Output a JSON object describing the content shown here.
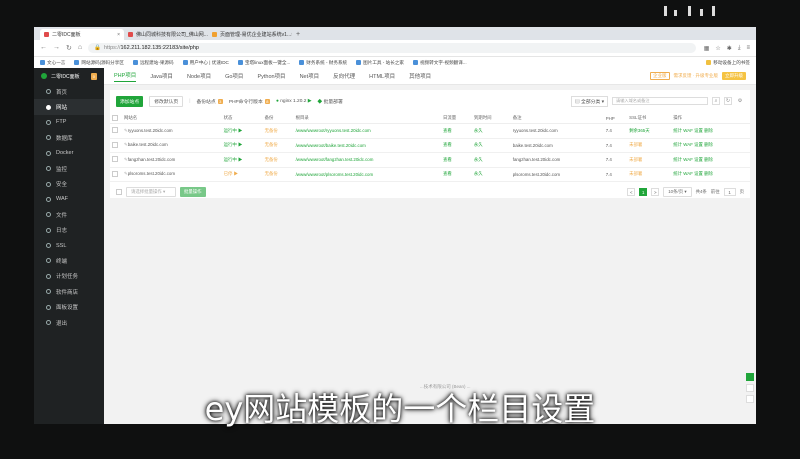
{
  "browser": {
    "tabs": [
      {
        "label": "二零IDC面板"
      },
      {
        "label": "佛山同城科技有限公司_佛山网..."
      },
      {
        "label": "页面管理-易优企业建站系统v1..."
      }
    ],
    "new_tab": "+",
    "url_prefix": "https://",
    "url": "162.211.182.135:22183/site/php",
    "bookmarks": [
      "文心一言",
      "网站源码|源码分享区",
      "远程建站-果源码",
      "用户中心 | 优速IDC",
      "宝塔linux面板一键全...",
      "财务系统 - 财务系统",
      "图片工具 - 站长之家",
      "视频转文字-视频翻译..."
    ],
    "bookmarks_right": "移动设备上的书签"
  },
  "sidebar": {
    "title": "二零IDC面板",
    "badge": "0",
    "items": [
      {
        "label": "首页"
      },
      {
        "label": "网站"
      },
      {
        "label": "FTP"
      },
      {
        "label": "数据库"
      },
      {
        "label": "Docker"
      },
      {
        "label": "监控"
      },
      {
        "label": "安全"
      },
      {
        "label": "WAF"
      },
      {
        "label": "文件"
      },
      {
        "label": "日志"
      },
      {
        "label": "SSL"
      },
      {
        "label": "终端"
      },
      {
        "label": "计划任务"
      },
      {
        "label": "软件商店"
      },
      {
        "label": "面板设置"
      },
      {
        "label": "退出"
      }
    ]
  },
  "topnav": {
    "tabs": [
      "PHP项目",
      "Java项目",
      "Node项目",
      "Go项目",
      "Python项目",
      "Net项目",
      "反向代理",
      "HTML项目",
      "其他项目"
    ],
    "tag": "企业版",
    "link": "需求反馈 · 升级专业版",
    "upgrade": "立即升级"
  },
  "toolbar": {
    "add_site": "添加站点",
    "default_page": "修改默认页",
    "sep": "|",
    "recycle": "备份站点",
    "recycle_count": "3",
    "php_cmd": "PHP命令行版本",
    "php_count": "8",
    "nginx": "nginx 1.20.2",
    "ssl": "批量部署",
    "category": "全部分类",
    "search_placeholder": "请输入域名或备注"
  },
  "table": {
    "headers": [
      "网站名",
      "状态",
      "备份",
      "根目录",
      "日流量",
      "到期时间",
      "备注",
      "PHP",
      "SSL证书",
      "操作"
    ],
    "rows": [
      {
        "name": "ryyuons.test.20idc.com",
        "status": "运行中 ▶",
        "backup": "无备份",
        "root": "/www/wwwroot/ryyuons.test.20idc.com",
        "traffic": "查看",
        "expire": "永久",
        "note": "ryyuons.test.20idc.com",
        "php": "7.4",
        "ssl": "剩余365天",
        "ops": [
          "统计",
          "WAF",
          "设置",
          "删除"
        ]
      },
      {
        "name": "baike.test.20idc.com",
        "status": "运行中 ▶",
        "backup": "无备份",
        "root": "/www/wwwroot/baike.test.20idc.com",
        "traffic": "查看",
        "expire": "永久",
        "note": "baike.test.20idc.com",
        "php": "7.4",
        "ssl": "未部署",
        "ops": [
          "统计",
          "WAF",
          "设置",
          "删除"
        ]
      },
      {
        "name": "fangzhan.test.20idc.com",
        "status": "运行中 ▶",
        "backup": "无备份",
        "root": "/www/wwwroot/fangzhan.test.20idc.com",
        "traffic": "查看",
        "expire": "永久",
        "note": "fangzhan.test.20idc.com",
        "php": "7.4",
        "ssl": "未部署",
        "ops": [
          "统计",
          "WAF",
          "设置",
          "删除"
        ]
      },
      {
        "name": "plsoroms.test.20idc.com",
        "status": "已停 ▶",
        "backup": "无备份",
        "root": "/www/wwwroot/plsoroms.test.20idc.com",
        "traffic": "查看",
        "expire": "永久",
        "note": "plsoroms.test.20idc.com",
        "php": "7.4",
        "ssl": "未部署",
        "ops": [
          "统计",
          "WAF",
          "设置",
          "删除"
        ]
      }
    ]
  },
  "footer": {
    "batch_placeholder": "请选择批量操作",
    "batch_btn": "批量操作",
    "prev": "<",
    "page": "1",
    "next": ">",
    "per_page": "10条/页",
    "total": "共4条",
    "goto": "前往",
    "goto_page": "1",
    "page_unit": "页"
  },
  "status_text": "...技术有限公司 (Bean) ...",
  "caption": "ey网站模板的一个栏目设置"
}
